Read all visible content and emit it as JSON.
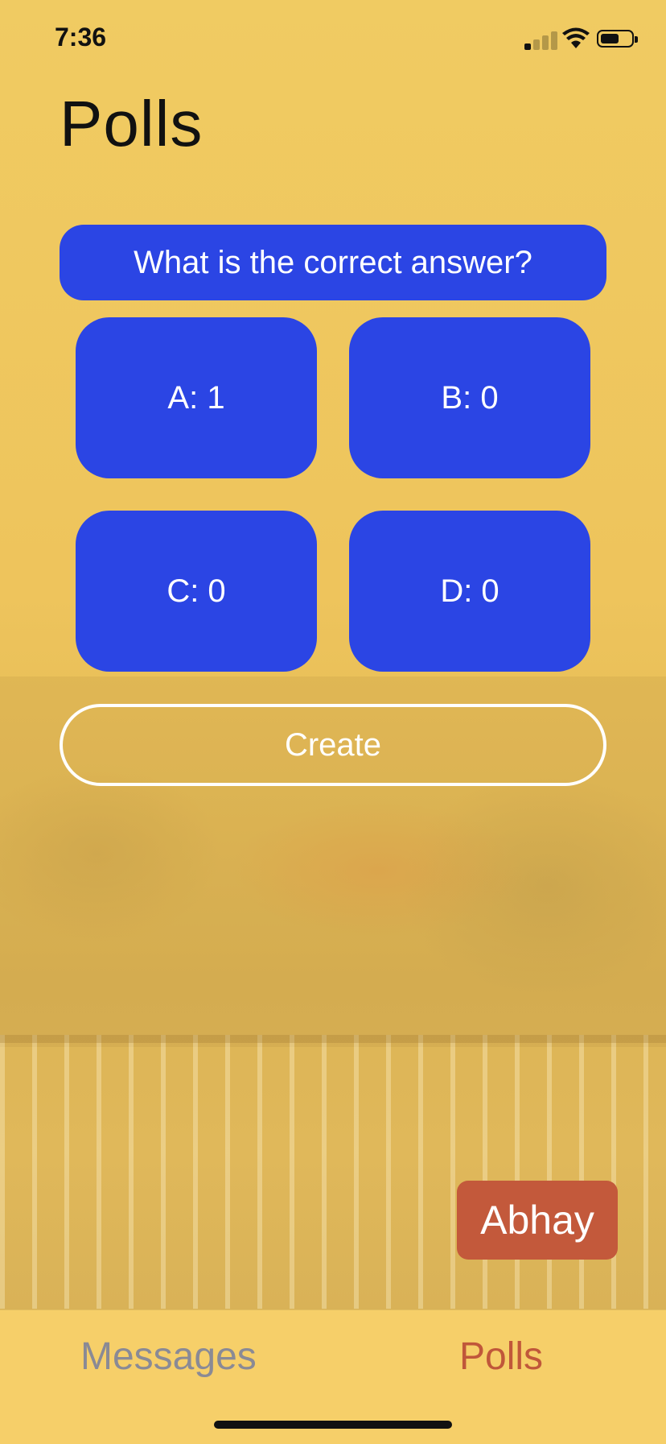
{
  "status_bar": {
    "time": "7:36",
    "icons": [
      "cellular-signal-icon",
      "wifi-icon",
      "battery-icon"
    ]
  },
  "page": {
    "title": "Polls"
  },
  "poll": {
    "question": "What is the correct answer?",
    "options": [
      {
        "label": "A: 1"
      },
      {
        "label": "B: 0"
      },
      {
        "label": "C: 0"
      },
      {
        "label": "D: 0"
      }
    ],
    "create_label": "Create"
  },
  "user_badge": {
    "name": "Abhay"
  },
  "tab_bar": {
    "items": [
      {
        "label": "Messages",
        "active": false
      },
      {
        "label": "Polls",
        "active": true
      }
    ]
  },
  "colors": {
    "background": "#f0ca60",
    "button_blue": "#2b45e4",
    "user_badge": "#c3593b",
    "tab_active": "#c0573a",
    "tab_inactive": "#8a8a95",
    "tab_bar": "#f6cf69"
  }
}
